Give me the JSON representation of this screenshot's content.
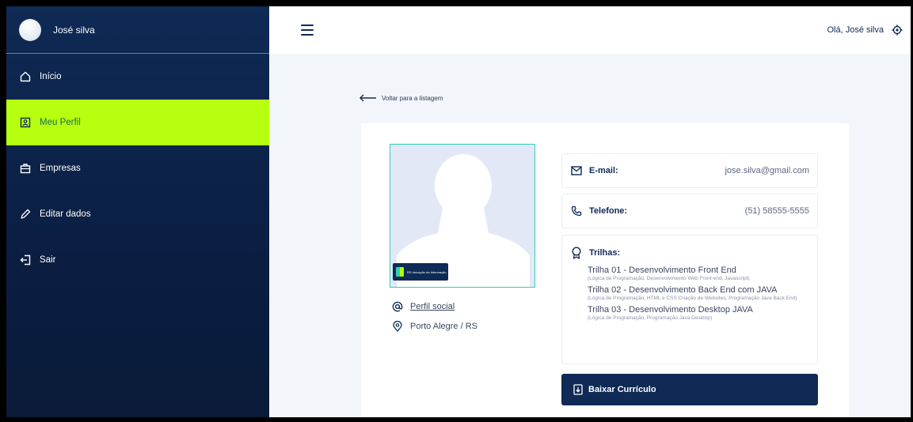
{
  "sidebar": {
    "user_name": "José silva",
    "items": [
      {
        "label": "Início",
        "icon": "home-icon"
      },
      {
        "label": "Meu Perfil",
        "icon": "profile-icon"
      },
      {
        "label": "Empresas",
        "icon": "briefcase-icon"
      },
      {
        "label": "Editar dados",
        "icon": "pencil-icon"
      },
      {
        "label": "Sair",
        "icon": "logout-icon"
      }
    ],
    "active_item": "Meu Perfil"
  },
  "topbar": {
    "greeting": "Olá, José silva"
  },
  "main": {
    "back_link": "Voltar para a listagem",
    "profile": {
      "social_link": "Perfil social",
      "location": "Porto Alegre / RS",
      "badge_text": "RS Inovação da Informação"
    },
    "fields": {
      "email_label": "E-mail:",
      "email_value": "jose.silva@gmail.com",
      "phone_label": "Telefone:",
      "phone_value": "(51) 58555-5555",
      "trilhas_label": "Trilhas:"
    },
    "trilhas": [
      {
        "title": "Trilha 01 - Desenvolvimento Front End",
        "sub": "(Lógica de Programação, Desenvolvimento Web Front-end, Javascript)"
      },
      {
        "title": "Trilha 02 - Desenvolvimento Back End com JAVA",
        "sub": "(Lógica de Programação, HTML e CSS Criação de Websites, Programação Java Back End)"
      },
      {
        "title": "Trilha 03 - Desenvolvimento Desktop JAVA",
        "sub": "(Lógica de Programação, Programação Java Desktop)"
      }
    ],
    "download_button": "Baixar Currículo"
  },
  "colors": {
    "navy": "#0e2a55",
    "lime": "#b6ff0e",
    "teal": "#2fd0b0",
    "page_bg": "#f2f6fa"
  }
}
